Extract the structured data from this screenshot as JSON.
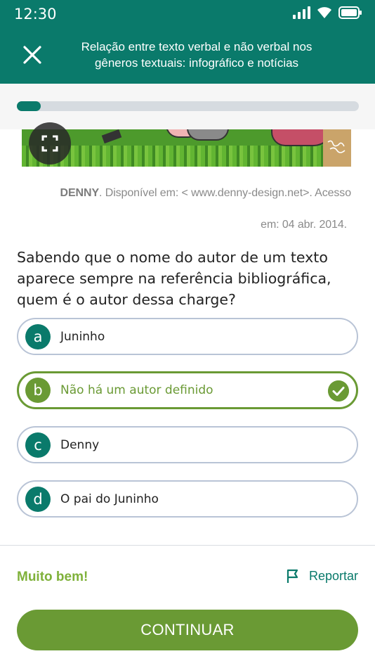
{
  "status_bar": {
    "time": "12:30"
  },
  "header": {
    "title": "Relação entre texto verbal e não verbal nos gêneros textuais: infográfico e notícias",
    "close_icon": "close-icon"
  },
  "progress": {
    "fraction": 0.07
  },
  "image": {
    "expand_icon": "expand-icon"
  },
  "caption": {
    "line1_author": "DENNY",
    "line1_rest": ". Disponível em: < www.denny-design.net>. Acesso",
    "line2": "em: 04 abr. 2014."
  },
  "question": "Sabendo que o nome do autor de um texto aparece sempre na referência bibliográfica, quem é o autor dessa charge?",
  "options": [
    {
      "letter": "a",
      "text": "Juninho"
    },
    {
      "letter": "b",
      "text": "Não há um autor definido"
    },
    {
      "letter": "c",
      "text": "Denny"
    },
    {
      "letter": "d",
      "text": "O pai do Juninho"
    }
  ],
  "selected_option": "b",
  "feedback": {
    "text": "Muito bem!"
  },
  "report": {
    "label": "Reportar",
    "icon": "flag-icon"
  },
  "continue_button": {
    "label": "CONTINUAR"
  },
  "colors": {
    "primary": "#0a7a6b",
    "success": "#6a9a34",
    "feedback": "#7fb13a"
  }
}
